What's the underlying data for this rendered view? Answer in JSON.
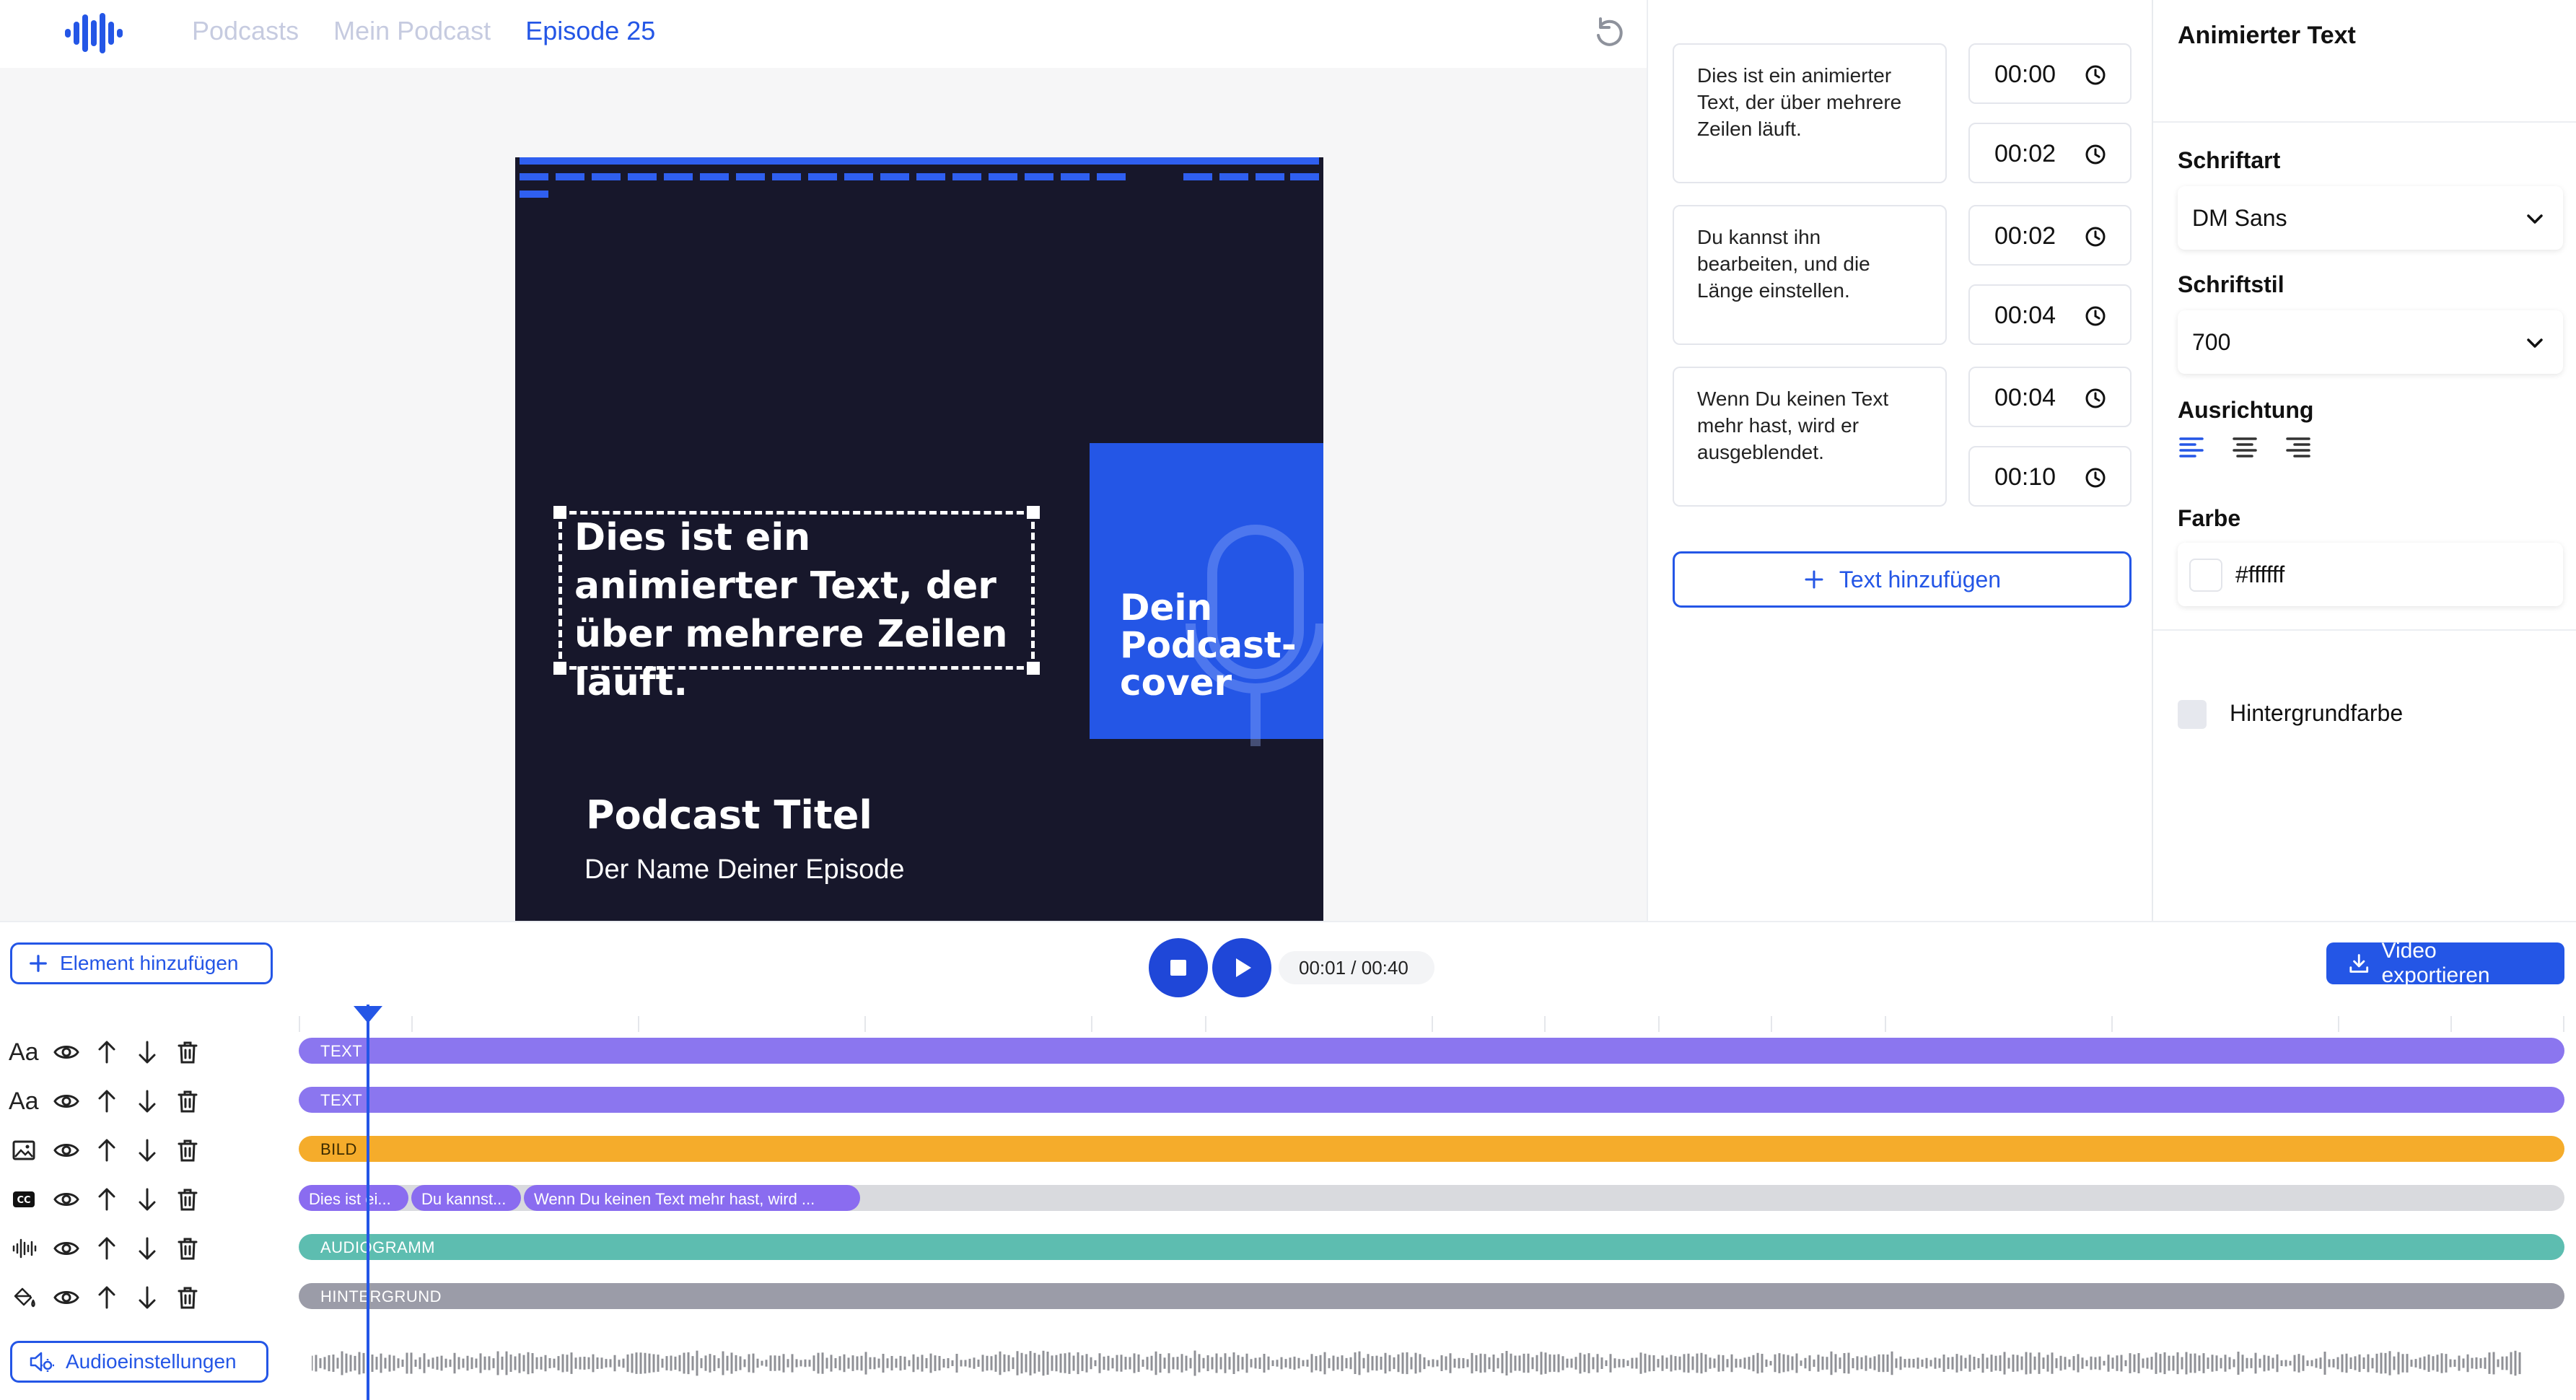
{
  "header": {
    "breadcrumbs": [
      "Podcasts",
      "Mein Podcast",
      "Episode 25"
    ]
  },
  "cover": {
    "animated_text": "Dies ist ein animierter Text, der über mehrere Zeilen läuft.",
    "badge_text": "Dein Podcast-cover",
    "title": "Podcast Titel",
    "subtitle": "Der Name Deiner Episode"
  },
  "captions": {
    "items": [
      {
        "text": "Dies ist ein animierter Text, der über mehrere Zeilen läuft.",
        "start": "00:00",
        "end": "00:02"
      },
      {
        "text": "Du kannst ihn bearbeiten, und die Länge einstellen.",
        "start": "00:02",
        "end": "00:04"
      },
      {
        "text": "Wenn Du keinen Text mehr hast, wird er ausgeblendet.",
        "start": "00:04",
        "end": "00:10"
      }
    ],
    "add_label": "Text hinzufügen"
  },
  "props": {
    "title": "Animierter Text",
    "font_label": "Schriftart",
    "font_value": "DM Sans",
    "style_label": "Schriftstil",
    "style_value": "700",
    "align_label": "Ausrichtung",
    "color_label": "Farbe",
    "color_value": "#ffffff",
    "bg_label": "Hintergrundfarbe"
  },
  "timeline": {
    "add_element": "Element hinzufügen",
    "timecode": "00:01 / 00:40",
    "export": "Video exportieren",
    "audio_settings": "Audioeinstellungen",
    "text_track_icon": "Aa",
    "tracks": [
      {
        "type": "text",
        "label": "TEXT",
        "color": "#8b76ef"
      },
      {
        "type": "text",
        "label": "TEXT",
        "color": "#8b76ef"
      },
      {
        "type": "image",
        "label": "BILD",
        "color": "#f5ac2b"
      },
      {
        "type": "captions",
        "label": "",
        "color": "#d9dade"
      },
      {
        "type": "audio",
        "label": "AUDIOGRAMM",
        "color": "#5dbdb0"
      },
      {
        "type": "background",
        "label": "HINTERGRUND",
        "color": "#9b9ca8"
      }
    ],
    "caption_chips": [
      "Dies ist ei...",
      "Du kannst...",
      "Wenn Du keinen Text mehr hast, wird ..."
    ]
  },
  "colors": {
    "accent": "#2456e6",
    "cover_background": "#17172b"
  }
}
